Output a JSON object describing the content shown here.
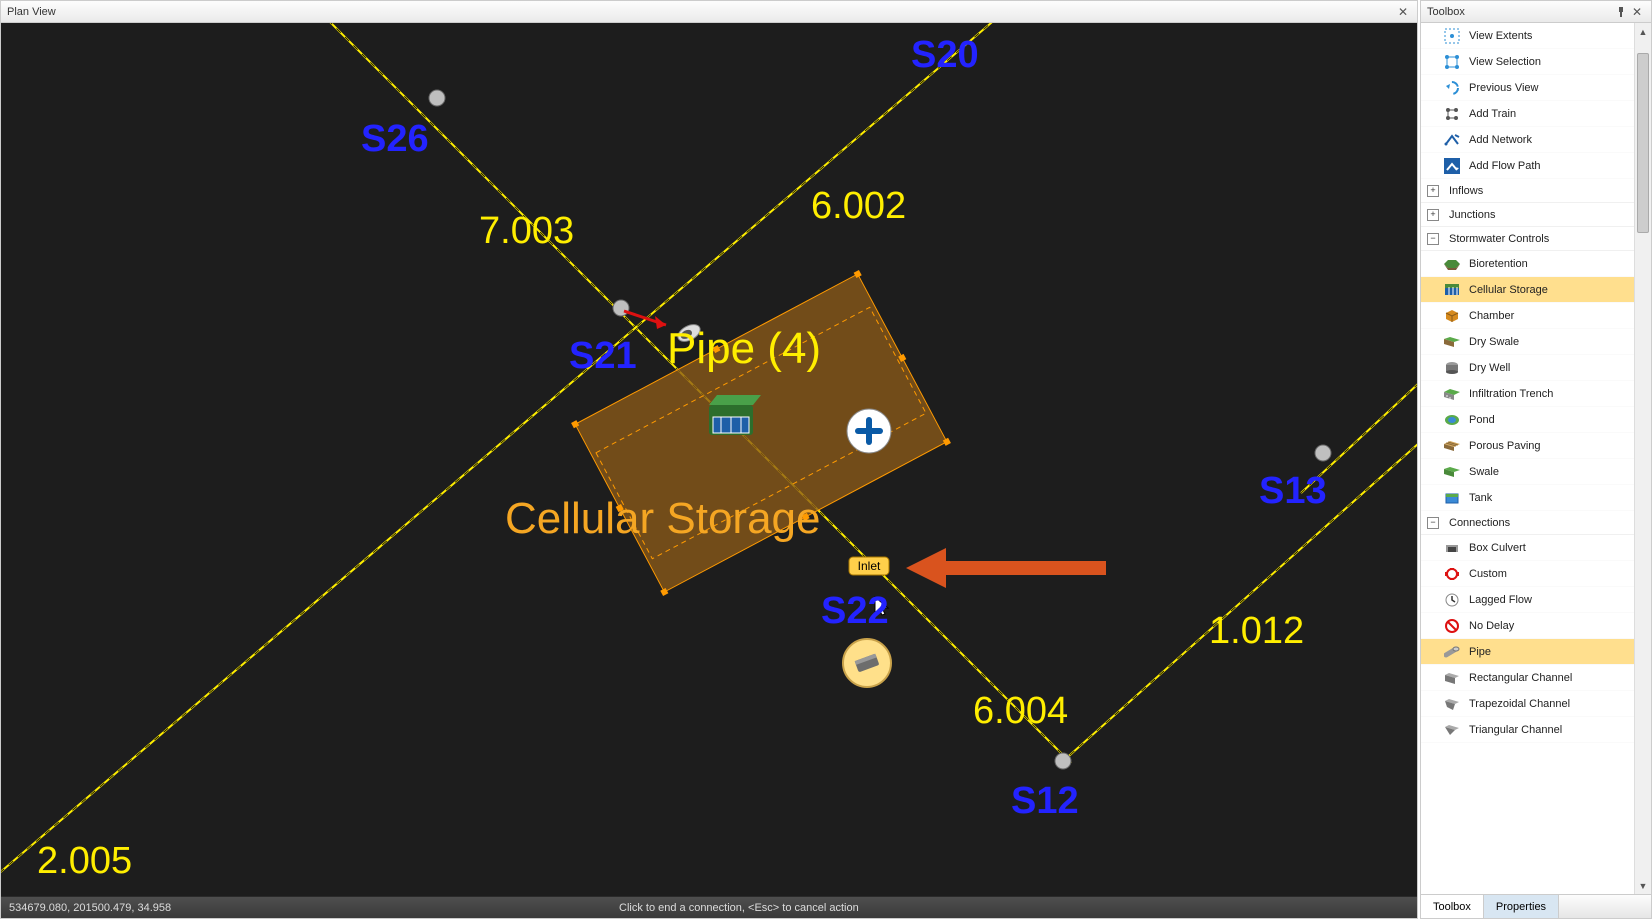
{
  "planview": {
    "title": "Plan View",
    "labels": {
      "S20": "S20",
      "S26": "S26",
      "S21": "S21",
      "S22": "S22",
      "S12": "S12",
      "S13": "S13",
      "len_7003": "7.003",
      "len_6002": "6.002",
      "len_6004": "6.004",
      "len_1012": "1.012",
      "len_partial": "2.005"
    },
    "pipe_label": "Pipe (4)",
    "swc_label": "Cellular Storage",
    "inlet_label": "Inlet"
  },
  "statusbar": {
    "coords": "534679.080, 201500.479, 34.958",
    "message": "Click to end a connection, <Esc> to cancel action"
  },
  "toolbox": {
    "title": "Toolbox",
    "nav_items": [
      {
        "key": "view-extents",
        "label": "View Extents"
      },
      {
        "key": "view-selection",
        "label": "View Selection"
      },
      {
        "key": "previous-view",
        "label": "Previous View"
      },
      {
        "key": "add-train",
        "label": "Add Train"
      },
      {
        "key": "add-network",
        "label": "Add Network"
      },
      {
        "key": "add-flow-path",
        "label": "Add Flow Path"
      }
    ],
    "groups": {
      "inflows": {
        "label": "Inflows",
        "expanded": false
      },
      "junctions": {
        "label": "Junctions",
        "expanded": false
      },
      "swc": {
        "label": "Stormwater Controls",
        "expanded": true
      },
      "connections": {
        "label": "Connections",
        "expanded": true
      }
    },
    "swc_items": [
      {
        "key": "bioretention",
        "label": "Bioretention"
      },
      {
        "key": "cellular-storage",
        "label": "Cellular Storage",
        "selected": true
      },
      {
        "key": "chamber",
        "label": "Chamber"
      },
      {
        "key": "dry-swale",
        "label": "Dry Swale"
      },
      {
        "key": "dry-well",
        "label": "Dry Well"
      },
      {
        "key": "infiltration-trench",
        "label": "Infiltration Trench"
      },
      {
        "key": "pond",
        "label": "Pond"
      },
      {
        "key": "porous-paving",
        "label": "Porous Paving"
      },
      {
        "key": "swale",
        "label": "Swale"
      },
      {
        "key": "tank",
        "label": "Tank"
      }
    ],
    "conn_items": [
      {
        "key": "box-culvert",
        "label": "Box Culvert"
      },
      {
        "key": "custom",
        "label": "Custom"
      },
      {
        "key": "lagged-flow",
        "label": "Lagged Flow"
      },
      {
        "key": "no-delay",
        "label": "No Delay"
      },
      {
        "key": "pipe",
        "label": "Pipe",
        "selected": true
      },
      {
        "key": "rectangular-channel",
        "label": "Rectangular Channel"
      },
      {
        "key": "trapezoidal-channel",
        "label": "Trapezoidal Channel"
      },
      {
        "key": "triangular-channel",
        "label": "Triangular Channel"
      }
    ],
    "tabs": {
      "toolbox": "Toolbox",
      "properties": "Properties"
    }
  }
}
